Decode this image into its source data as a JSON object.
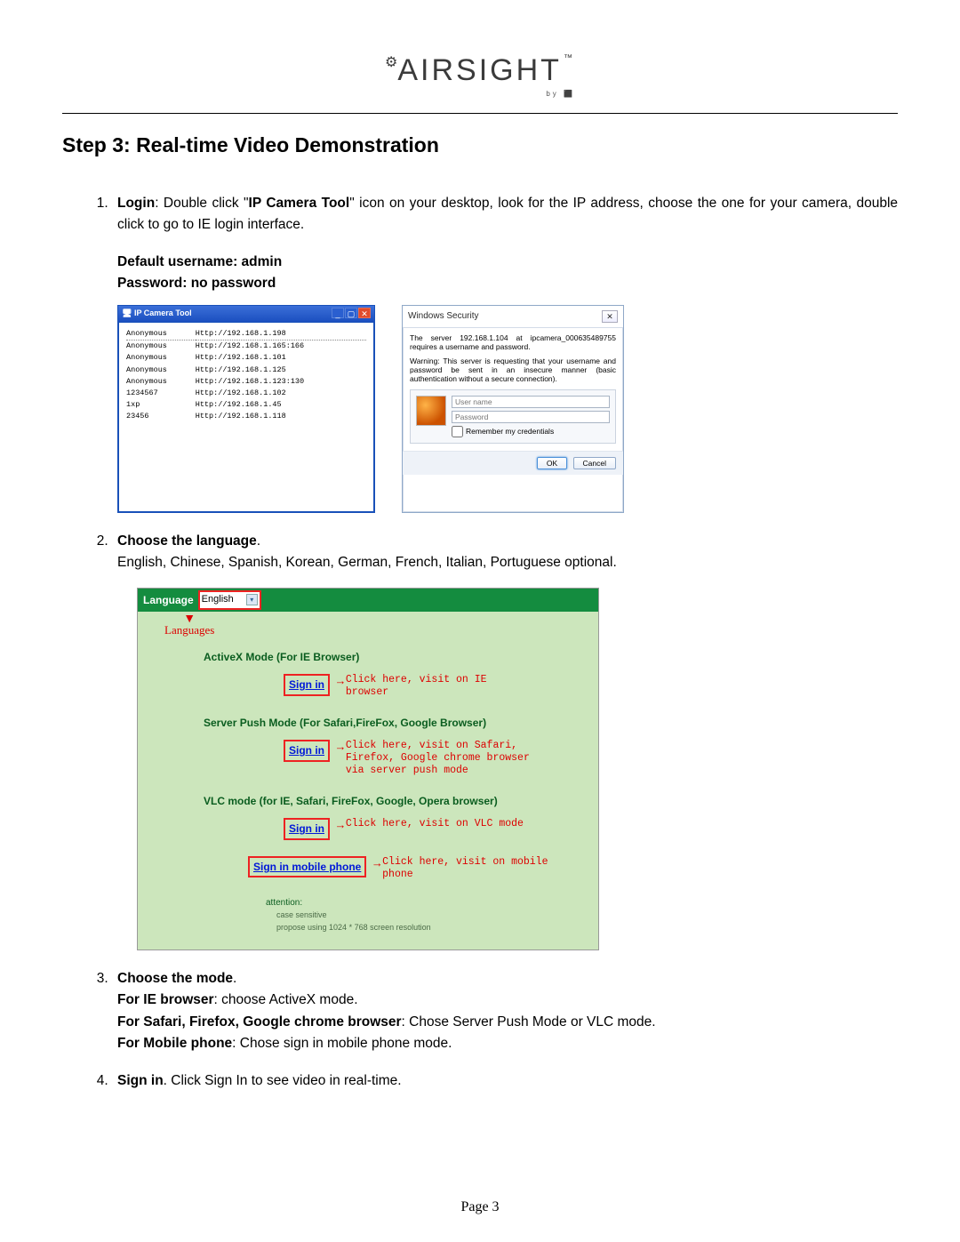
{
  "brand": {
    "name": "AIRSIGHT",
    "tm": "™",
    "sub": "by ⬛"
  },
  "title": "Step 3: Real-time Video Demonstration",
  "items": {
    "login_label": "Login",
    "login_text_a": ": Double click \"",
    "login_tool": "IP Camera Tool",
    "login_text_b": "\" icon on your desktop, look for the IP address, choose the one for your camera, double click to go to IE login interface.",
    "creds_user": "Default username: admin",
    "creds_pass": "Password: no password",
    "choose_lang_label": "Choose the language",
    "choose_lang_period": ".",
    "choose_lang_text": "English, Chinese, Spanish, Korean, German, French, Italian, Portuguese optional.",
    "choose_mode_label": "Choose the mode",
    "choose_mode_period": ".",
    "mode_ie_label": "For IE browser",
    "mode_ie_text": ": choose ActiveX mode.",
    "mode_push_label": "For Safari, Firefox, Google chrome browser",
    "mode_push_text": ": Chose Server Push Mode or VLC mode.",
    "mode_mobile_label": "For Mobile phone",
    "mode_mobile_text": ": Chose sign in mobile phone mode.",
    "signin_label": "Sign in",
    "signin_text": ". Click Sign In to see video in real-time."
  },
  "ip_tool": {
    "title": "IP Camera Tool",
    "rows": [
      {
        "name": "Anonymous",
        "url": "Http://192.168.1.198"
      },
      {
        "name": "Anonymous",
        "url": "Http://192.168.1.165:166"
      },
      {
        "name": "Anonymous",
        "url": "Http://192.168.1.101"
      },
      {
        "name": "Anonymous",
        "url": "Http://192.168.1.125"
      },
      {
        "name": "Anonymous",
        "url": "Http://192.168.1.123:130"
      },
      {
        "name": "1234567",
        "url": "Http://192.168.1.102"
      },
      {
        "name": "1xp",
        "url": "Http://192.168.1.45"
      },
      {
        "name": "23456",
        "url": "Http://192.168.1.118"
      }
    ]
  },
  "sec": {
    "title": "Windows Security",
    "msg1": "The server 192.168.1.104 at ipcamera_000635489755 requires a username and password.",
    "msg2": "Warning: This server is requesting that your username and password be sent in an insecure manner (basic authentication without a secure connection).",
    "user_ph": "User name",
    "pass_ph": "Password",
    "remember": "Remember my credentials",
    "ok": "OK",
    "cancel": "Cancel"
  },
  "green": {
    "lang_label": "Language",
    "lang_value": "English",
    "lang_annot": "Languages",
    "s1_title": "ActiveX Mode (For IE Browser)",
    "s1_annot": "Click here, visit on IE browser",
    "s2_title": "Server Push Mode (For Safari,FireFox, Google Browser)",
    "s2_annot": "Click here, visit on Safari, Firefox, Google chrome browser via server push mode",
    "s3_title": "VLC mode (for IE, Safari, FireFox, Google, Opera browser)",
    "s3_annot": "Click here, visit on VLC mode",
    "s4_annot": "Click here, visit on mobile phone",
    "signin": "Sign in",
    "signin_mobile": "Sign in mobile phone",
    "attn": "attention:",
    "attn1": "case sensitive",
    "attn2": "propose using 1024 * 768 screen resolution"
  },
  "footer": {
    "label": "Page",
    "num": "3"
  }
}
